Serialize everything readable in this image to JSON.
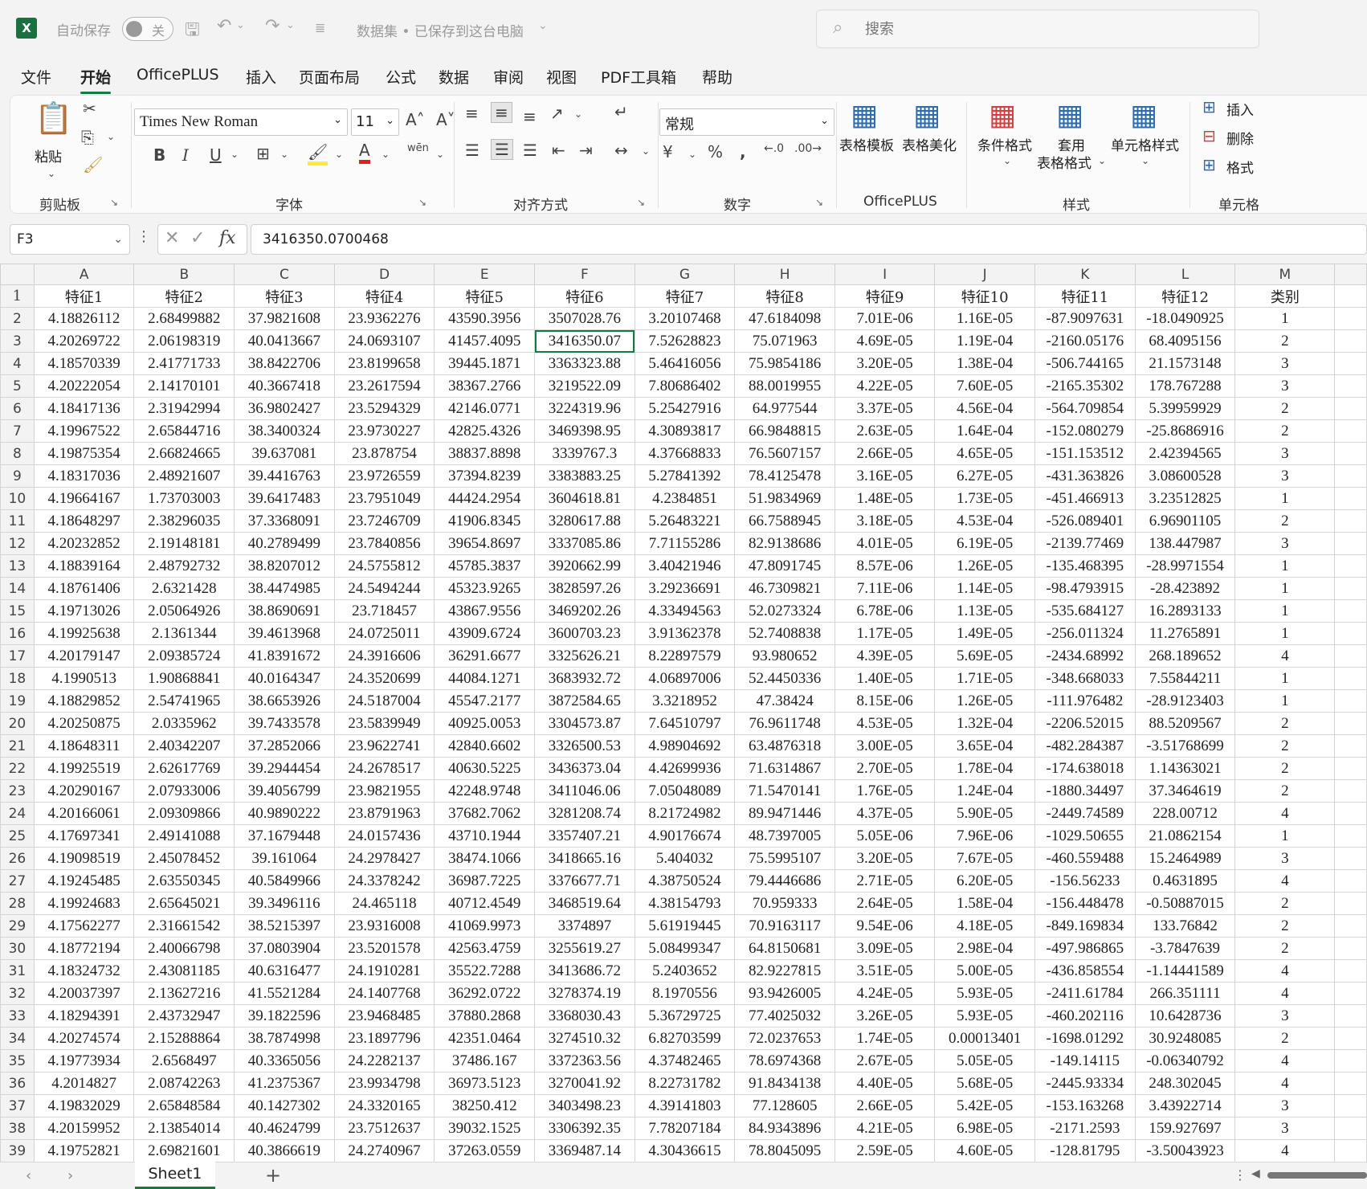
{
  "titlebar": {
    "app_logo": "X",
    "autosave_label": "自动保存",
    "autosave_state": "关",
    "doc_title": "数据集 • 已保存到这台电脑",
    "search_placeholder": "搜索"
  },
  "menu": {
    "tabs": [
      "文件",
      "开始",
      "OfficePLUS",
      "插入",
      "页面布局",
      "公式",
      "数据",
      "审阅",
      "视图",
      "PDF工具箱",
      "帮助"
    ],
    "active": "开始"
  },
  "ribbon": {
    "clipboard": {
      "paste_label": "粘贴",
      "group_label": "剪贴板"
    },
    "font": {
      "family": "Times New Roman",
      "size": "11",
      "group_label": "字体",
      "bold": "B",
      "italic": "I",
      "underline": "U",
      "grow": "A^",
      "shrink": "A˅"
    },
    "alignment": {
      "group_label": "对齐方式"
    },
    "number": {
      "format": "常规",
      "group_label": "数字",
      "percent": "%"
    },
    "officeplus": {
      "template_label": "表格模板",
      "beautify_label": "表格美化",
      "group_label": "OfficePLUS"
    },
    "styles": {
      "conditional_label": "条件格式",
      "table_format_label_1": "套用",
      "table_format_label_2": "表格格式",
      "cell_style_label": "单元格样式",
      "group_label": "样式"
    },
    "cells": {
      "insert_label": "插入",
      "delete_label": "删除",
      "format_label": "格式",
      "group_label": "单元格"
    }
  },
  "formula_bar": {
    "name_box": "F3",
    "formula": "3416350.0700468"
  },
  "grid": {
    "columns": [
      "A",
      "B",
      "C",
      "D",
      "E",
      "F",
      "G",
      "H",
      "I",
      "J",
      "K",
      "L",
      "M"
    ],
    "selected_cell": "F3",
    "rows": [
      [
        "特征1",
        "特征2",
        "特征3",
        "特征4",
        "特征5",
        "特征6",
        "特征7",
        "特征8",
        "特征9",
        "特征10",
        "特征11",
        "特征12",
        "类别"
      ],
      [
        "4.18826112",
        "2.68499882",
        "37.9821608",
        "23.9362276",
        "43590.3956",
        "3507028.76",
        "3.20107468",
        "47.6184098",
        "7.01E-06",
        "1.16E-05",
        "-87.9097631",
        "-18.0490925",
        "1"
      ],
      [
        "4.20269722",
        "2.06198319",
        "40.0413667",
        "24.0693107",
        "41457.4095",
        "3416350.07",
        "7.52628823",
        "75.071963",
        "4.69E-05",
        "1.19E-04",
        "-2160.05176",
        "68.4095156",
        "2"
      ],
      [
        "4.18570339",
        "2.41771733",
        "38.8422706",
        "23.8199658",
        "39445.1871",
        "3363323.88",
        "5.46416056",
        "75.9854186",
        "3.20E-05",
        "1.38E-04",
        "-506.744165",
        "21.1573148",
        "3"
      ],
      [
        "4.20222054",
        "2.14170101",
        "40.3667418",
        "23.2617594",
        "38367.2766",
        "3219522.09",
        "7.80686402",
        "88.0019955",
        "4.22E-05",
        "7.60E-05",
        "-2165.35302",
        "178.767288",
        "3"
      ],
      [
        "4.18417136",
        "2.31942994",
        "36.9802427",
        "23.5294329",
        "42146.0771",
        "3224319.96",
        "5.25427916",
        "64.977544",
        "3.37E-05",
        "4.56E-04",
        "-564.709854",
        "5.39959929",
        "2"
      ],
      [
        "4.19967522",
        "2.65844716",
        "38.3400324",
        "23.9730227",
        "42825.4326",
        "3469398.95",
        "4.30893817",
        "66.9848815",
        "2.63E-05",
        "1.64E-04",
        "-152.080279",
        "-25.8686916",
        "2"
      ],
      [
        "4.19875354",
        "2.66824665",
        "39.637081",
        "23.878754",
        "38837.8898",
        "3339767.3",
        "4.37668833",
        "76.5607157",
        "2.66E-05",
        "4.65E-05",
        "-151.153512",
        "2.42394565",
        "3"
      ],
      [
        "4.18317036",
        "2.48921607",
        "39.4416763",
        "23.9726559",
        "37394.8239",
        "3383883.25",
        "5.27841392",
        "78.4125478",
        "3.16E-05",
        "6.27E-05",
        "-431.363826",
        "3.08600528",
        "3"
      ],
      [
        "4.19664167",
        "1.73703003",
        "39.6417483",
        "23.7951049",
        "44424.2954",
        "3604618.81",
        "4.2384851",
        "51.9834969",
        "1.48E-05",
        "1.73E-05",
        "-451.466913",
        "3.23512825",
        "1"
      ],
      [
        "4.18648297",
        "2.38296035",
        "37.3368091",
        "23.7246709",
        "41906.8345",
        "3280617.88",
        "5.26483221",
        "66.7588945",
        "3.18E-05",
        "4.53E-04",
        "-526.089401",
        "6.96901105",
        "2"
      ],
      [
        "4.20232852",
        "2.19148181",
        "40.2789499",
        "23.7840856",
        "39654.8697",
        "3337085.86",
        "7.71155286",
        "82.9138686",
        "4.01E-05",
        "6.19E-05",
        "-2139.77469",
        "138.447987",
        "3"
      ],
      [
        "4.18839164",
        "2.48792732",
        "38.8207012",
        "24.5755812",
        "45785.3837",
        "3920662.99",
        "3.40421946",
        "47.8091745",
        "8.57E-06",
        "1.26E-05",
        "-135.468395",
        "-28.9971554",
        "1"
      ],
      [
        "4.18761406",
        "2.6321428",
        "38.4474985",
        "24.5494244",
        "45323.9265",
        "3828597.26",
        "3.29236691",
        "46.7309821",
        "7.11E-06",
        "1.14E-05",
        "-98.4793915",
        "-28.423892",
        "1"
      ],
      [
        "4.19713026",
        "2.05064926",
        "38.8690691",
        "23.718457",
        "43867.9556",
        "3469202.26",
        "4.33494563",
        "52.0273324",
        "6.78E-06",
        "1.13E-05",
        "-535.684127",
        "16.2893133",
        "1"
      ],
      [
        "4.19925638",
        "2.1361344",
        "39.4613968",
        "24.0725011",
        "43909.6724",
        "3600703.23",
        "3.91362378",
        "52.7408838",
        "1.17E-05",
        "1.49E-05",
        "-256.011324",
        "11.2765891",
        "1"
      ],
      [
        "4.20179147",
        "2.09385724",
        "41.8391672",
        "24.3916606",
        "36291.6677",
        "3325626.21",
        "8.22897579",
        "93.980652",
        "4.39E-05",
        "5.69E-05",
        "-2434.68992",
        "268.189652",
        "4"
      ],
      [
        "4.1990513",
        "1.90868841",
        "40.0164347",
        "24.3520699",
        "44084.1271",
        "3683932.72",
        "4.06897006",
        "52.4450336",
        "1.40E-05",
        "1.71E-05",
        "-348.668033",
        "7.55844211",
        "1"
      ],
      [
        "4.18829852",
        "2.54741965",
        "38.6653926",
        "24.5187004",
        "45547.2177",
        "3872584.65",
        "3.3218952",
        "47.38424",
        "8.15E-06",
        "1.26E-05",
        "-111.976482",
        "-28.9123403",
        "1"
      ],
      [
        "4.20250875",
        "2.0335962",
        "39.7433578",
        "23.5839949",
        "40925.0053",
        "3304573.87",
        "7.64510797",
        "76.9611748",
        "4.53E-05",
        "1.32E-04",
        "-2206.52015",
        "88.5209567",
        "2"
      ],
      [
        "4.18648311",
        "2.40342207",
        "37.2852066",
        "23.9622741",
        "42840.6602",
        "3326500.53",
        "4.98904692",
        "63.4876318",
        "3.00E-05",
        "3.65E-04",
        "-482.284387",
        "-3.51768699",
        "2"
      ],
      [
        "4.19925519",
        "2.62617769",
        "39.2944454",
        "24.2678517",
        "40630.5225",
        "3436373.04",
        "4.42699936",
        "71.6314867",
        "2.70E-05",
        "1.78E-04",
        "-174.638018",
        "1.14363021",
        "2"
      ],
      [
        "4.20290167",
        "2.07933006",
        "39.4056799",
        "23.9821955",
        "42248.9748",
        "3411046.06",
        "7.05048089",
        "71.5470141",
        "1.76E-05",
        "1.24E-04",
        "-1880.34497",
        "37.3464619",
        "2"
      ],
      [
        "4.20166061",
        "2.09309866",
        "40.9890222",
        "23.8791963",
        "37682.7062",
        "3281208.74",
        "8.21724982",
        "89.9471446",
        "4.37E-05",
        "5.90E-05",
        "-2449.74589",
        "228.00712",
        "4"
      ],
      [
        "4.17697341",
        "2.49141088",
        "37.1679448",
        "24.0157436",
        "43710.1944",
        "3357407.21",
        "4.90176674",
        "48.7397005",
        "5.05E-06",
        "7.96E-06",
        "-1029.50655",
        "21.0862154",
        "1"
      ],
      [
        "4.19098519",
        "2.45078452",
        "39.161064",
        "24.2978427",
        "38474.1066",
        "3418665.16",
        "5.404032",
        "75.5995107",
        "3.20E-05",
        "7.67E-05",
        "-460.559488",
        "15.2464989",
        "3"
      ],
      [
        "4.19245485",
        "2.63550345",
        "40.5849966",
        "24.3378242",
        "36987.7225",
        "3376677.71",
        "4.38750524",
        "79.4446686",
        "2.71E-05",
        "6.20E-05",
        "-156.56233",
        "0.4631895",
        "4"
      ],
      [
        "4.19924683",
        "2.65645021",
        "39.3496116",
        "24.465118",
        "40712.4549",
        "3468519.64",
        "4.38154793",
        "70.959333",
        "2.64E-05",
        "1.58E-04",
        "-156.448478",
        "-0.50887015",
        "2"
      ],
      [
        "4.17562277",
        "2.31661542",
        "38.5215397",
        "23.9316008",
        "41069.9973",
        "3374897",
        "5.61919445",
        "70.9163117",
        "9.54E-06",
        "4.18E-05",
        "-849.169834",
        "133.76842",
        "2"
      ],
      [
        "4.18772194",
        "2.40066798",
        "37.0803904",
        "23.5201578",
        "42563.4759",
        "3255619.27",
        "5.08499347",
        "64.8150681",
        "3.09E-05",
        "2.98E-04",
        "-497.986865",
        "-3.7847639",
        "2"
      ],
      [
        "4.18324732",
        "2.43081185",
        "40.6316477",
        "24.1910281",
        "35522.7288",
        "3413686.72",
        "5.2403652",
        "82.9227815",
        "3.51E-05",
        "5.00E-05",
        "-436.858554",
        "-1.14441589",
        "4"
      ],
      [
        "4.20037397",
        "2.13627216",
        "41.5521284",
        "24.1407768",
        "36292.0722",
        "3278374.19",
        "8.1970556",
        "93.9426005",
        "4.24E-05",
        "5.93E-05",
        "-2411.61784",
        "266.351111",
        "4"
      ],
      [
        "4.18294391",
        "2.43732947",
        "39.1822596",
        "23.9468485",
        "37880.2868",
        "3368030.43",
        "5.36729725",
        "77.4025032",
        "3.26E-05",
        "5.93E-05",
        "-460.202116",
        "10.6428736",
        "3"
      ],
      [
        "4.20274574",
        "2.15288864",
        "38.7874998",
        "23.1897796",
        "42351.0464",
        "3274510.32",
        "6.82703599",
        "72.0237653",
        "1.74E-05",
        "0.00013401",
        "-1698.01292",
        "30.9248085",
        "2"
      ],
      [
        "4.19773934",
        "2.6568497",
        "40.3365056",
        "24.2282137",
        "37486.167",
        "3372363.56",
        "4.37482465",
        "78.6974368",
        "2.67E-05",
        "5.05E-05",
        "-149.14115",
        "-0.06340792",
        "4"
      ],
      [
        "4.2014827",
        "2.08742263",
        "41.2375367",
        "23.9934798",
        "36973.5123",
        "3270041.92",
        "8.22731782",
        "91.8434138",
        "4.40E-05",
        "5.68E-05",
        "-2445.93334",
        "248.302045",
        "4"
      ],
      [
        "4.19832029",
        "2.65848584",
        "40.1427302",
        "24.3320165",
        "38250.412",
        "3403498.23",
        "4.39141803",
        "77.128605",
        "2.66E-05",
        "5.42E-05",
        "-153.163268",
        "3.43922714",
        "3"
      ],
      [
        "4.20159952",
        "2.13854014",
        "40.4624799",
        "23.7512637",
        "39032.1525",
        "3306392.35",
        "7.78207184",
        "84.9343896",
        "4.21E-05",
        "6.98E-05",
        "-2171.2593",
        "159.927697",
        "3"
      ],
      [
        "4.19752821",
        "2.69821601",
        "40.3866619",
        "24.2740967",
        "37263.0559",
        "3369487.14",
        "4.30436615",
        "78.8045095",
        "2.59E-05",
        "4.60E-05",
        "-128.81795",
        "-3.50043923",
        "4"
      ]
    ]
  },
  "sheets": {
    "tabs": [
      "Sheet1"
    ],
    "add_label": "+"
  },
  "colors": {
    "accent": "#117e3f",
    "excel_green": "#1d6f42",
    "selection": "#107c41"
  }
}
